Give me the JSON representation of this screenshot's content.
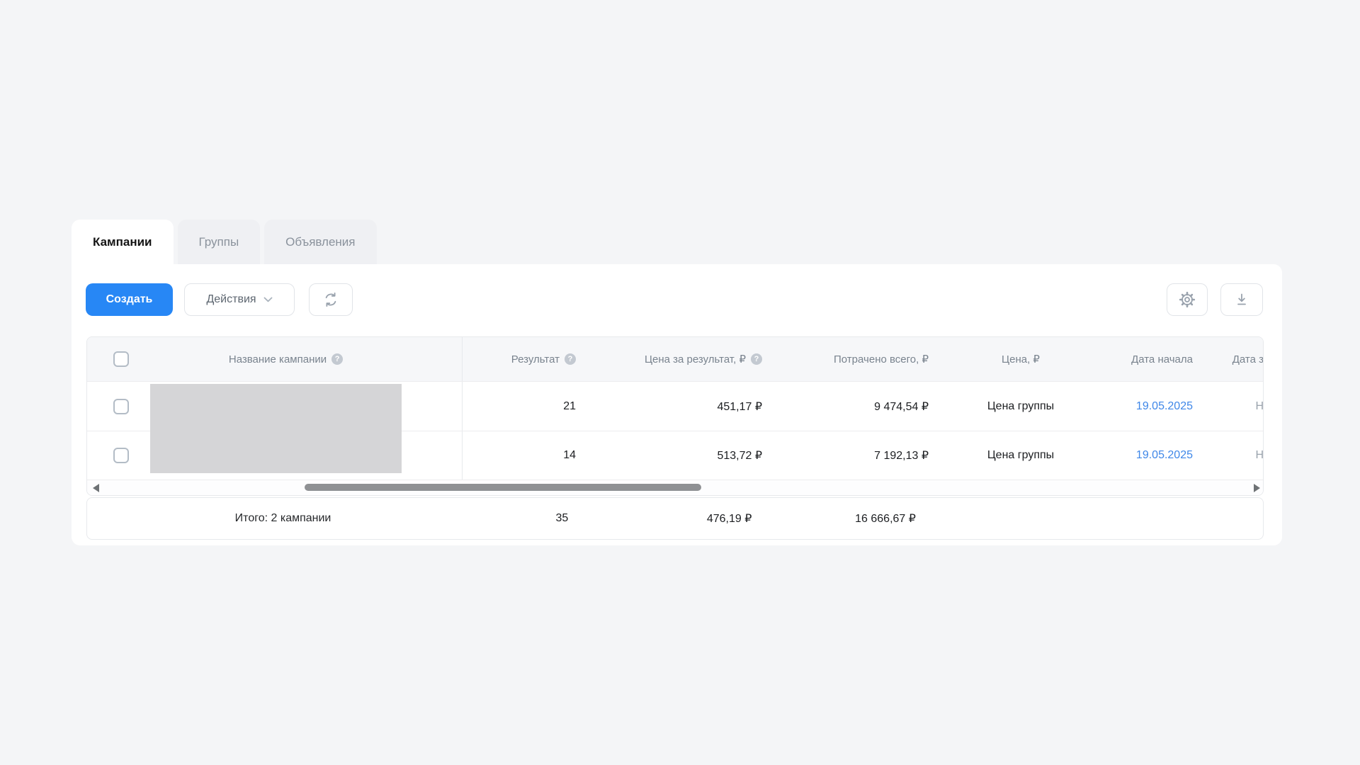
{
  "tabs": [
    {
      "label": "Кампании",
      "active": true
    },
    {
      "label": "Группы",
      "active": false
    },
    {
      "label": "Объявления",
      "active": false
    }
  ],
  "toolbar": {
    "create_label": "Создать",
    "actions_label": "Действия",
    "refresh_icon": "refresh-icon",
    "settings_icon": "gear-icon",
    "download_icon": "download-icon"
  },
  "table": {
    "header": {
      "name": "Название кампании",
      "result": "Результат",
      "cost_per_result": "Цена за результат, ₽",
      "spent_total": "Потрачено всего, ₽",
      "price": "Цена, ₽",
      "date_start": "Дата начала",
      "date_end_partial": "Дата з"
    },
    "rows": [
      {
        "result": "21",
        "cost_per_result": "451,17 ₽",
        "spent_total": "9 474,54 ₽",
        "price": "Цена группы",
        "date_start": "19.05.2025",
        "date_end_partial": "Н"
      },
      {
        "result": "14",
        "cost_per_result": "513,72 ₽",
        "spent_total": "7 192,13 ₽",
        "price": "Цена группы",
        "date_start": "19.05.2025",
        "date_end_partial": "Н"
      }
    ],
    "totals": {
      "label": "Итого: 2 кампании",
      "result": "35",
      "cost_per_result": "476,19 ₽",
      "spent_total": "16 666,67 ₽"
    }
  },
  "icons": {
    "help_glyph": "?"
  },
  "colors": {
    "accent_blue": "#2787f5",
    "link_blue": "#3f87e8",
    "page_background": "#f4f5f7",
    "panel_background": "#ffffff",
    "muted_text": "#9aa3ad",
    "redacted_gray": "#d5d5d7"
  }
}
